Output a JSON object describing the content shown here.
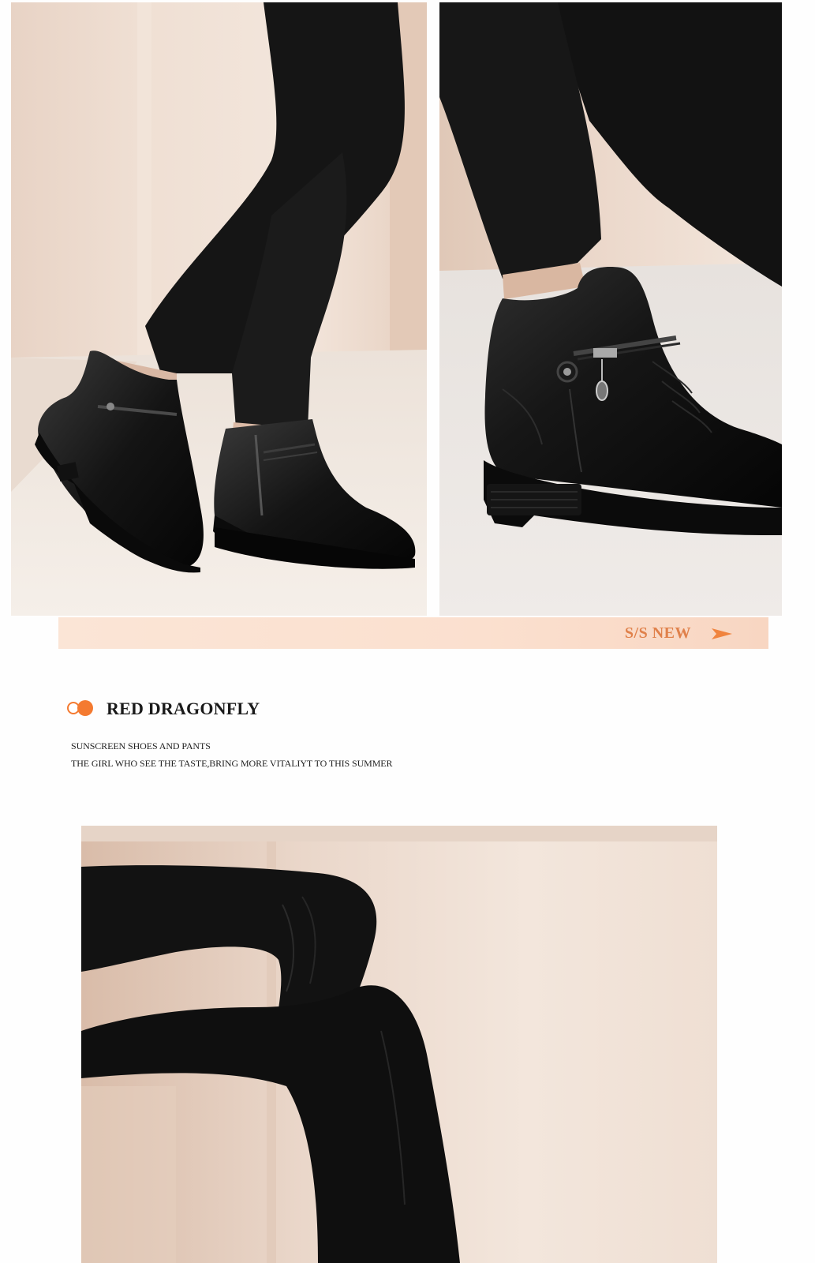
{
  "banner": {
    "label": "S/S NEW",
    "accent_color": "#e0814b",
    "arrow_icon": "arrow-right-icon"
  },
  "brand": {
    "title": "RED DRAGONFLY",
    "accent_color": "#f47a30",
    "icon": "double-circle-icon"
  },
  "taglines": {
    "line1": "SUNSCREEN SHOES AND PANTS",
    "line2": "THE GIRL WHO SEE THE TASTE,BRING MORE VITALIYT TO THIS SUMMER"
  }
}
